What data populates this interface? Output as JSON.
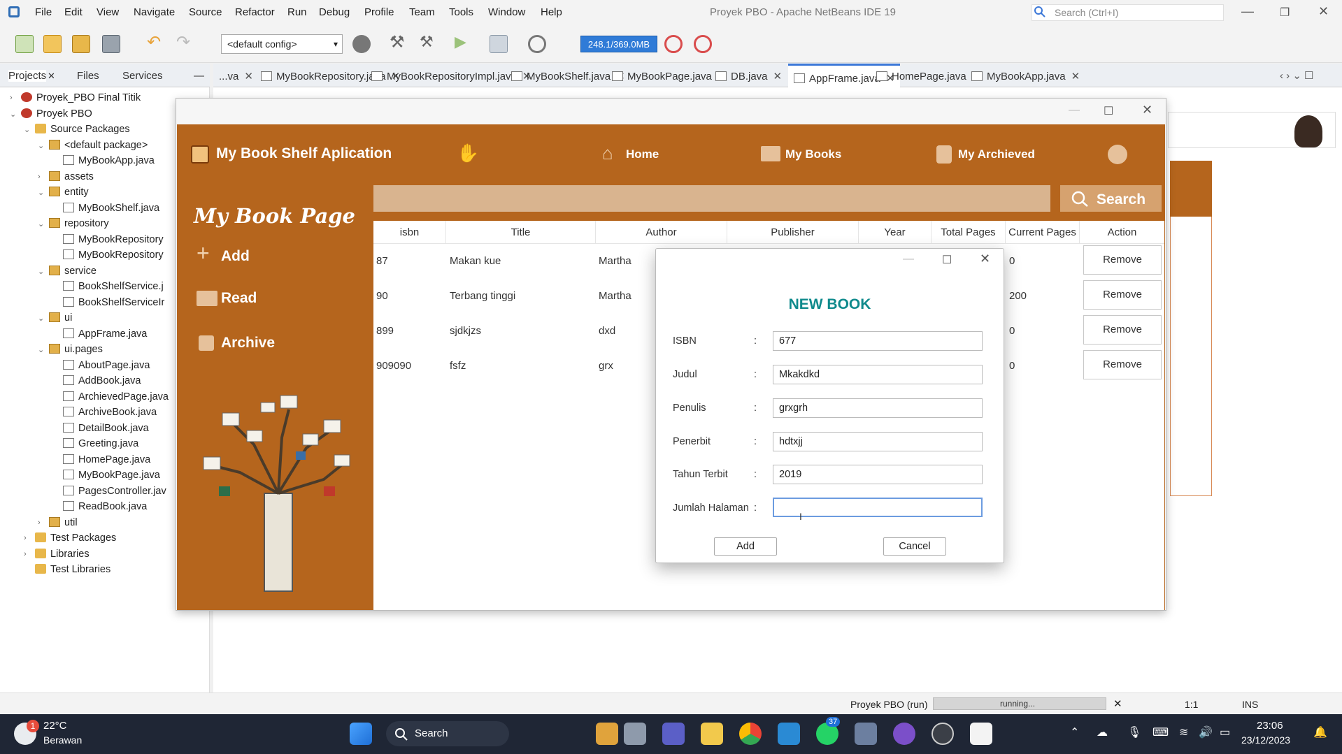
{
  "ide": {
    "menu": [
      "File",
      "Edit",
      "View",
      "Navigate",
      "Source",
      "Refactor",
      "Run",
      "Debug",
      "Profile",
      "Team",
      "Tools",
      "Window",
      "Help"
    ],
    "title": "Proyek PBO - Apache NetBeans IDE 19",
    "search_placeholder": "Search (Ctrl+I)",
    "config": "<default config>",
    "memory": "248.1/369.0MB"
  },
  "projects_panel": {
    "tabs": [
      "Projects",
      "Files",
      "Services"
    ],
    "tree": [
      {
        "label": "Proyek_PBO Final Titik",
        "type": "proj"
      },
      {
        "label": "Proyek PBO",
        "type": "proj"
      },
      {
        "label": "Source Packages",
        "type": "folder"
      },
      {
        "label": "<default package>",
        "type": "pkg"
      },
      {
        "label": "MyBookApp.java",
        "type": "file"
      },
      {
        "label": "assets",
        "type": "pkg"
      },
      {
        "label": "entity",
        "type": "pkg"
      },
      {
        "label": "MyBookShelf.java",
        "type": "file"
      },
      {
        "label": "repository",
        "type": "pkg"
      },
      {
        "label": "MyBookRepository",
        "type": "file"
      },
      {
        "label": "MyBookRepository",
        "type": "file"
      },
      {
        "label": "service",
        "type": "pkg"
      },
      {
        "label": "BookShelfService.j",
        "type": "file"
      },
      {
        "label": "BookShelfServiceIr",
        "type": "file"
      },
      {
        "label": "ui",
        "type": "pkg"
      },
      {
        "label": "AppFrame.java",
        "type": "file"
      },
      {
        "label": "ui.pages",
        "type": "pkg"
      },
      {
        "label": "AboutPage.java",
        "type": "file"
      },
      {
        "label": "AddBook.java",
        "type": "file"
      },
      {
        "label": "ArchievedPage.java",
        "type": "file"
      },
      {
        "label": "ArchiveBook.java",
        "type": "file"
      },
      {
        "label": "DetailBook.java",
        "type": "file"
      },
      {
        "label": "Greeting.java",
        "type": "file"
      },
      {
        "label": "HomePage.java",
        "type": "file"
      },
      {
        "label": "MyBookPage.java",
        "type": "file"
      },
      {
        "label": "PagesController.jav",
        "type": "file"
      },
      {
        "label": "ReadBook.java",
        "type": "file"
      },
      {
        "label": "util",
        "type": "pkg"
      },
      {
        "label": "Test Packages",
        "type": "folder"
      },
      {
        "label": "Libraries",
        "type": "folder"
      },
      {
        "label": "Test Libraries",
        "type": "folder"
      }
    ]
  },
  "editor_tabs": [
    {
      "label": "...va"
    },
    {
      "label": "MyBookRepository.java"
    },
    {
      "label": "MyBookRepositoryImpl.java"
    },
    {
      "label": "MyBookShelf.java"
    },
    {
      "label": "MyBookPage.java"
    },
    {
      "label": "DB.java"
    },
    {
      "label": "AppFrame.java",
      "active": true
    },
    {
      "label": "HomePage.java"
    },
    {
      "label": "MyBookApp.java"
    }
  ],
  "app": {
    "title": "My Book Shelf Aplication",
    "nav": {
      "home": "Home",
      "my_books": "My Books",
      "my_archived": "My Archieved"
    },
    "page_title": "My Book Page",
    "side": {
      "add": "Add",
      "read": "Read",
      "archive": "Archive"
    },
    "search_button": "Search",
    "table": {
      "columns": [
        "isbn",
        "Title",
        "Author",
        "Publisher",
        "Year",
        "Total Pages",
        "Current Pages",
        "Action"
      ],
      "rows": [
        {
          "isbn": "87",
          "title": "Makan kue",
          "author": "Martha",
          "current": "0",
          "action": "Remove"
        },
        {
          "isbn": "90",
          "title": "Terbang tinggi",
          "author": "Martha",
          "current": "200",
          "action": "Remove"
        },
        {
          "isbn": "899",
          "title": "sjdkjzs",
          "author": "dxd",
          "current": "0",
          "action": "Remove"
        },
        {
          "isbn": "909090",
          "title": "fsfz",
          "author": "grx",
          "current": "0",
          "action": "Remove"
        }
      ]
    }
  },
  "dialog": {
    "title": "NEW BOOK",
    "fields": [
      {
        "label": "ISBN",
        "value": "677"
      },
      {
        "label": "Judul",
        "value": "Mkakdkd"
      },
      {
        "label": "Penulis",
        "value": "grxgrh"
      },
      {
        "label": "Penerbit",
        "value": "hdtxjj"
      },
      {
        "label": "Tahun Terbit",
        "value": "2019"
      },
      {
        "label": "Jumlah Halaman",
        "value": ""
      }
    ],
    "colon": ":",
    "add_button": "Add",
    "cancel_button": "Cancel"
  },
  "status": {
    "run_label": "Proyek PBO (run)",
    "progress_text": "running...",
    "position": "1:1",
    "mode": "INS"
  },
  "taskbar": {
    "weather_temp": "22°C",
    "weather_desc": "Berawan",
    "weather_badge": "1",
    "search_label": "Search",
    "whatsapp_badge": "37",
    "time": "23:06",
    "date": "23/12/2023"
  }
}
